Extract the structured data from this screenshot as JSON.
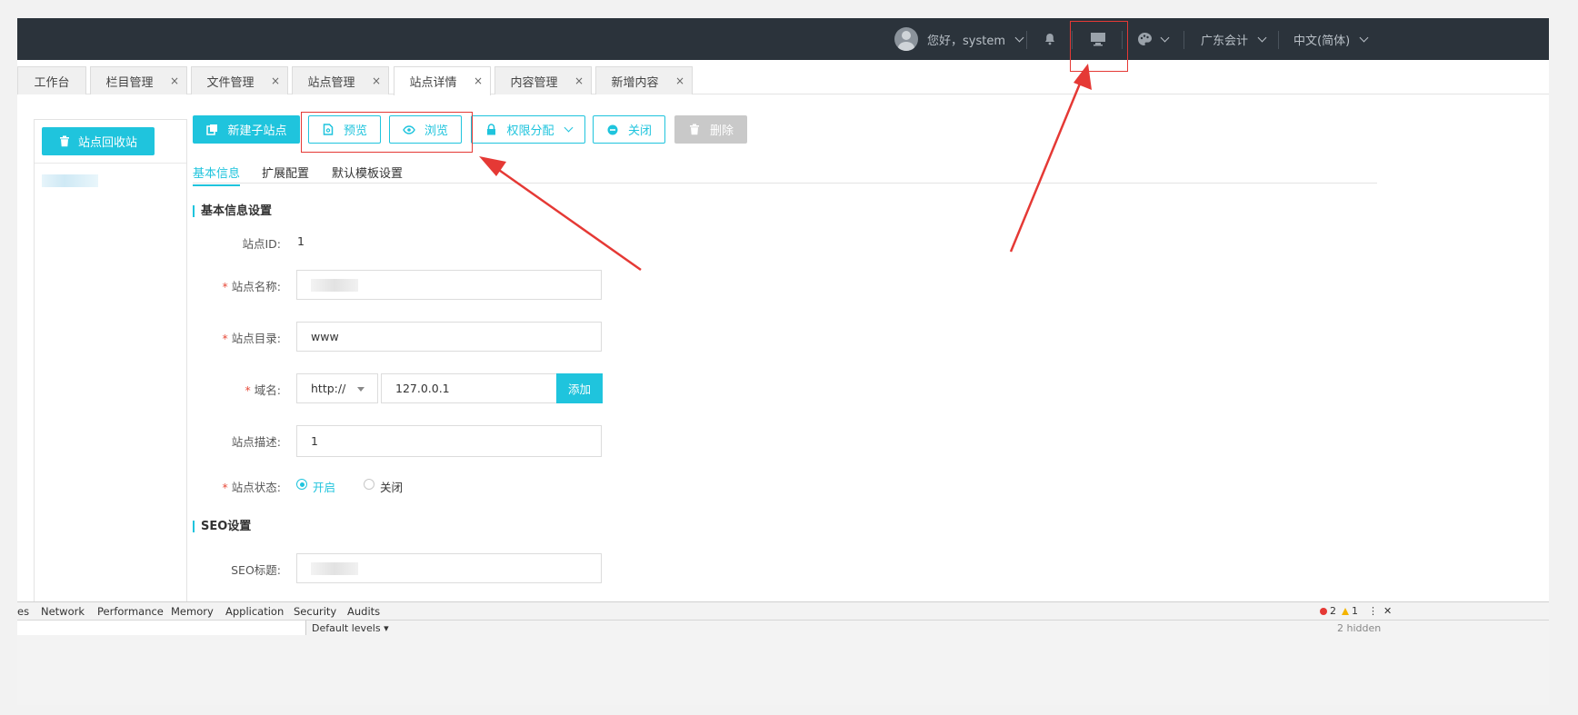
{
  "topbar": {
    "greeting": "您好，system",
    "org": "广东会计",
    "language": "中文(简体)",
    "icons": [
      "avatar",
      "bell-icon",
      "monitor-icon",
      "palette-icon"
    ]
  },
  "tabs": [
    {
      "label": "工作台",
      "closable": false
    },
    {
      "label": "栏目管理",
      "closable": true
    },
    {
      "label": "文件管理",
      "closable": true
    },
    {
      "label": "站点管理",
      "closable": true
    },
    {
      "label": "站点详情",
      "closable": true,
      "active": true
    },
    {
      "label": "内容管理",
      "closable": true
    },
    {
      "label": "新增内容",
      "closable": true
    }
  ],
  "close_glyph": "×",
  "sidebar": {
    "recycle_label": "站点回收站"
  },
  "toolbar": {
    "new_subsite": "新建子站点",
    "preview": "预览",
    "browse": "浏览",
    "permissions": "权限分配",
    "close": "关闭",
    "delete": "删除"
  },
  "sub_tabs": [
    "基本信息",
    "扩展配置",
    "默认模板设置"
  ],
  "basic_section": {
    "title": "基本信息设置",
    "site_id_label": "站点ID:",
    "site_id_value": "1",
    "site_name_label": "站点名称:",
    "site_dir_label": "站点目录:",
    "site_dir_value": "www",
    "domain_label": "域名:",
    "protocol": "http://",
    "domain_value": "127.0.0.1",
    "add_label": "添加",
    "desc_label": "站点描述:",
    "desc_value": "1",
    "status_label": "站点状态:",
    "status_on": "开启",
    "status_off": "关闭",
    "required_mark": "*"
  },
  "seo_section": {
    "title": "SEO设置",
    "seo_title_label": "SEO标题:"
  },
  "devtools": {
    "tabs": [
      "es",
      "Network",
      "Performance",
      "Memory",
      "Application",
      "Security",
      "Audits"
    ],
    "levels": "Default levels ▾",
    "errors": "2",
    "warnings": "1",
    "hidden": "2 hidden",
    "more": "⋮",
    "close": "✕"
  },
  "colors": {
    "accent": "#1fc4dd",
    "topbar": "#2b333b",
    "annotation": "#e53935"
  }
}
